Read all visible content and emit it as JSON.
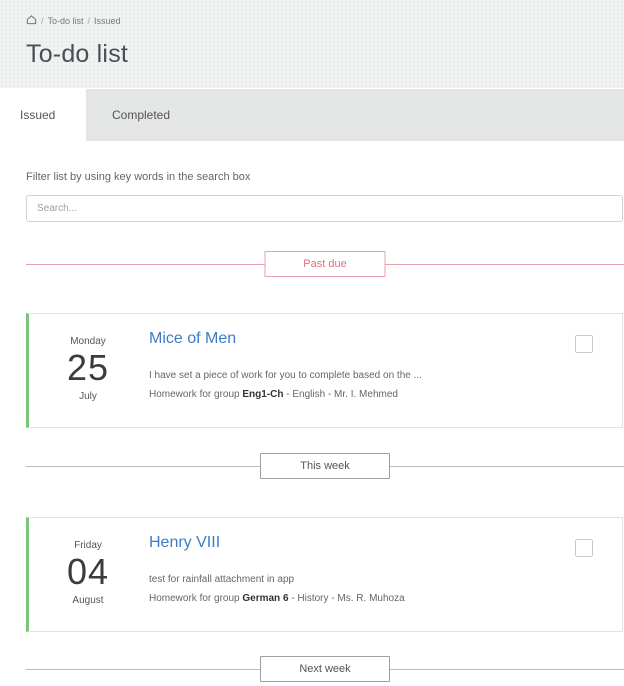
{
  "breadcrumb": {
    "home_icon": "home-icon",
    "items": [
      "To-do list",
      "Issued"
    ],
    "separator": "/"
  },
  "page_title": "To-do list",
  "tabs": [
    {
      "label": "Issued",
      "active": true
    },
    {
      "label": "Completed",
      "active": false
    }
  ],
  "filter": {
    "label": "Filter list by using key words in the search box",
    "placeholder": "Search...",
    "value": ""
  },
  "sections": {
    "past_due": "Past due",
    "this_week": "This week",
    "next_week": "Next week"
  },
  "tasks": [
    {
      "weekday": "Monday",
      "day": "25",
      "month": "July",
      "title": "Mice of Men",
      "description": "I have set a piece of work for you to complete based on the ...",
      "meta_prefix": "Homework for group ",
      "group": "Eng1-Ch",
      "meta_suffix": " - English - Mr. I. Mehmed",
      "checked": false
    },
    {
      "weekday": "Friday",
      "day": "04",
      "month": "August",
      "title": "Henry VIII",
      "description": "test for rainfall attachment in app",
      "meta_prefix": "Homework for group ",
      "group": "German 6",
      "meta_suffix": " - History - Ms. R. Muhoza",
      "checked": false
    }
  ],
  "colors": {
    "accent_link": "#3c7cc4",
    "card_border_left": "#7cc47a",
    "past_due": "#e0707f"
  }
}
